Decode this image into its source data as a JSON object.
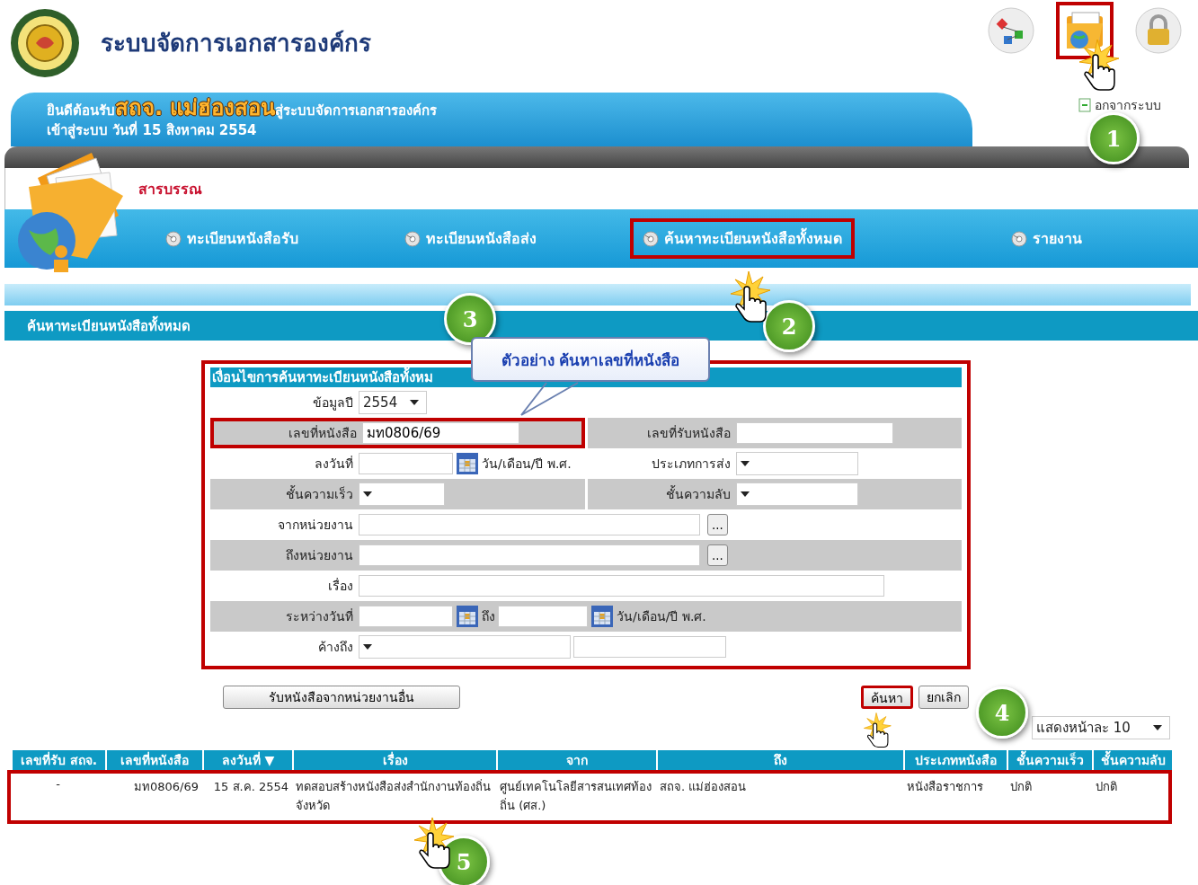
{
  "header": {
    "title": "ระบบจัดการเอกสารองค์กร",
    "toolbar_icons": [
      {
        "kind": "sitemap",
        "highlighted": false
      },
      {
        "kind": "folder",
        "highlighted": true
      },
      {
        "kind": "lock",
        "highlighted": false
      }
    ],
    "logout_link": "อกจากระบบ"
  },
  "welcome": {
    "greeting": "ยินดีต้อนรับ",
    "org": "สถจ. แม่ฮ่องสอน",
    "suffix": "สู่ระบบจัดการเอกสารองค์กร",
    "login_line": "เข้าสู่ระบบ วันที่ 15 สิงหาคม 2554"
  },
  "module_title": "สารบรรณ",
  "menu": [
    {
      "label": "ทะเบียนหนังสือรับ",
      "highlighted": false
    },
    {
      "label": "ทะเบียนหนังสือส่ง",
      "highlighted": false
    },
    {
      "label": "ค้นหาทะเบียนหนังสือทั้งหมด",
      "highlighted": true
    },
    {
      "label": "รายงาน",
      "highlighted": false
    }
  ],
  "section_title": "ค้นหาทะเบียนหนังสือทั้งหมด",
  "search_form": {
    "title": "เงื่อนไขการค้นหาทะเบียนหนังสือทั้งหม",
    "highlighted": true,
    "rows": [
      {
        "shaded": false,
        "cells": [
          {
            "label": "ข้อมูลปี",
            "kind": "select",
            "value": "2554"
          }
        ]
      },
      {
        "shaded": true,
        "cells": [
          {
            "label": "เลขที่หนังสือ",
            "kind": "text",
            "value": "มท0806/69",
            "highlighted": true
          },
          {
            "label": "เลขที่รับหนังสือ",
            "kind": "text",
            "highlighted": false
          }
        ]
      },
      {
        "shaded": false,
        "cells": [
          {
            "label": "ลงวันที่",
            "kind": "date",
            "suffix": "วัน/เดือน/ปี พ.ศ."
          },
          {
            "label": "ประเภทการส่ง",
            "kind": "select"
          }
        ]
      },
      {
        "shaded": true,
        "cells": [
          {
            "label": "ชั้นความเร็ว",
            "kind": "select"
          },
          {
            "label": "ชั้นความลับ",
            "kind": "select"
          }
        ]
      },
      {
        "shaded": false,
        "cells": [
          {
            "label": "จากหน่วยงาน",
            "kind": "picker",
            "browse": "..."
          }
        ]
      },
      {
        "shaded": true,
        "cells": [
          {
            "label": "ถึงหน่วยงาน",
            "kind": "picker",
            "browse": "..."
          }
        ]
      },
      {
        "shaded": false,
        "cells": [
          {
            "label": "เรื่อง",
            "kind": "wide"
          }
        ]
      },
      {
        "shaded": true,
        "cells": [
          {
            "label": "ระหว่างวันที่",
            "kind": "daterange",
            "between": "ถึง",
            "suffix": "วัน/เดือน/ปี พ.ศ."
          }
        ]
      },
      {
        "shaded": false,
        "cells": [
          {
            "label": "ค้างถึง",
            "kind": "select_text"
          }
        ]
      }
    ]
  },
  "buttons": [
    {
      "label": "รับหนังสือจากหน่วยงานอื่น",
      "kind": "left",
      "highlighted": false
    },
    {
      "label": "ค้นหา",
      "kind": "right",
      "highlighted": true
    },
    {
      "label": "ยกเลิก",
      "kind": "right",
      "highlighted": false
    }
  ],
  "page_size": "แสดงหน้าละ 10",
  "table": {
    "columns": [
      "เลขที่รับ สถจ.",
      "เลขที่หนังสือ",
      "ลงวันที่ ▼",
      "เรื่อง",
      "จาก",
      "ถึง",
      "ประเภทหนังสือ",
      "ชั้นความเร็ว",
      "ชั้นความลับ"
    ],
    "rows": [
      {
        "highlighted": true,
        "cells": [
          "-",
          "มท0806/69",
          "15 ส.ค. 2554",
          "ทดสอบสร้างหนังสือส่งสำนักงานท้องถิ่นจังหวัด",
          "ศูนย์เทคโนโลยีสารสนเทศท้องถิ่น (ศส.)",
          "สถจ. แม่ฮ่องสอน",
          "หนังสือราชการ",
          "ปกติ",
          "ปกติ"
        ]
      }
    ]
  },
  "annotations": {
    "steps": [
      "1",
      "2",
      "3",
      "4",
      "5"
    ],
    "callout": "ตัวอย่าง ค้นหาเลขที่หนังสือ"
  }
}
